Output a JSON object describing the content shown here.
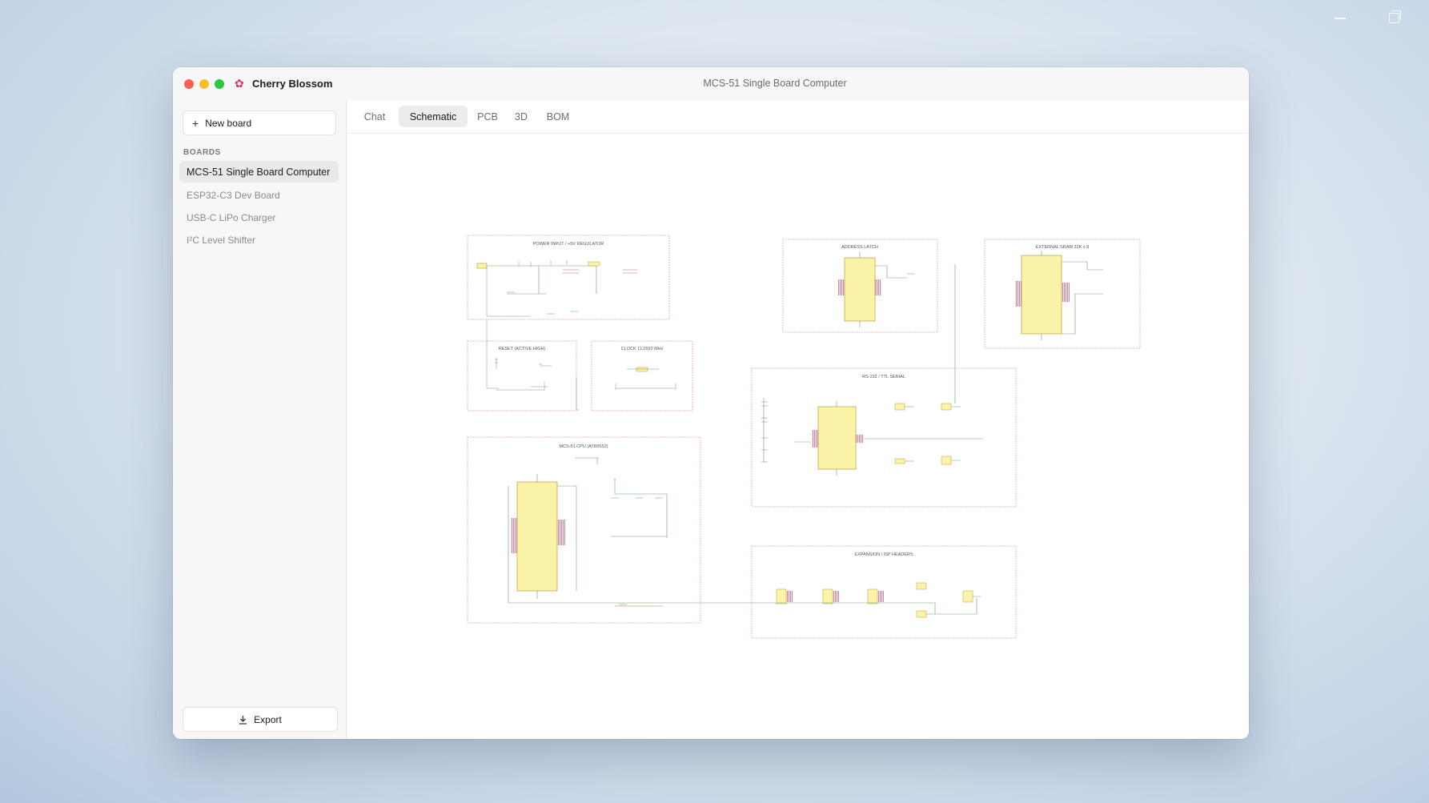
{
  "app": {
    "name": "Cherry Blossom",
    "window_title": "MCS-51 Single Board Computer",
    "logo_icon": "cherry-blossom-icon"
  },
  "sidebar": {
    "new_board_label": "New board",
    "section_label": "BOARDS",
    "boards": [
      {
        "label": "MCS-51 Single Board Computer",
        "active": true
      },
      {
        "label": "ESP32-C3 Dev Board",
        "active": false
      },
      {
        "label": "USB-C LiPo Charger",
        "active": false
      },
      {
        "label": "I²C Level Shifter",
        "active": false
      }
    ],
    "export_label": "Export"
  },
  "tabs": [
    {
      "label": "Chat",
      "active": false
    },
    {
      "label": "Schematic",
      "active": true
    },
    {
      "label": "PCB",
      "active": false
    },
    {
      "label": "3D",
      "active": false
    },
    {
      "label": "BOM",
      "active": false
    }
  ],
  "schematic": {
    "blocks": [
      {
        "title": "POWER INPUT / +5V REGULATOR"
      },
      {
        "title": "ADDRESS LATCH"
      },
      {
        "title": "EXTERNAL SRAM 32K x 8"
      },
      {
        "title": "RESET (ACTIVE HIGH)"
      },
      {
        "title": "CLOCK 11.0592 MHz"
      },
      {
        "title": "RS-232 / TTL SERIAL"
      },
      {
        "title": "MCS-51 CPU (AT89S52)"
      },
      {
        "title": "EXPANSION / ISP HEADERS"
      }
    ]
  },
  "colors": {
    "block_border": "#e8a8b4",
    "chip_fill": "#fbf3a8",
    "chip_stroke": "#b99a3a",
    "wire": "#6aa06a",
    "close": "#ff5f57",
    "minimize": "#febc2e",
    "maximize": "#28c840"
  }
}
